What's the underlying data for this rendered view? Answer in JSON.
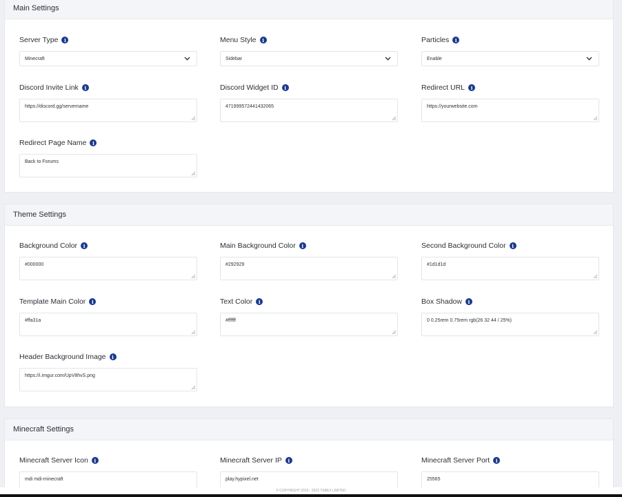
{
  "main_settings": {
    "title": "Main Settings",
    "server_type": {
      "label": "Server Type",
      "value": "Minecraft"
    },
    "menu_style": {
      "label": "Menu Style",
      "value": "Sidebar"
    },
    "particles": {
      "label": "Particles",
      "value": "Enable"
    },
    "discord_invite": {
      "label": "Discord Invite Link",
      "value": "https://discord.gg/servername"
    },
    "discord_widget": {
      "label": "Discord Widget ID",
      "value": "471999572441432065"
    },
    "redirect_url": {
      "label": "Redirect URL",
      "value": "https://yourwebsite.com"
    },
    "redirect_page_name": {
      "label": "Redirect Page Name",
      "value": "Back to Forums"
    }
  },
  "theme_settings": {
    "title": "Theme Settings",
    "background_color": {
      "label": "Background Color",
      "value": "#000000"
    },
    "main_background_color": {
      "label": "Main Background Color",
      "value": "#292929"
    },
    "second_background_color": {
      "label": "Second Background Color",
      "value": "#1d1d1d"
    },
    "template_main_color": {
      "label": "Template Main Color",
      "value": "#ffa31a"
    },
    "text_color": {
      "label": "Text Color",
      "value": "#ffffff"
    },
    "box_shadow": {
      "label": "Box Shadow",
      "value": "0 0.25rem 0.75rem rgb(26 32 44 / 25%)"
    },
    "header_background_image": {
      "label": "Header Background Image",
      "value": "https://i.imgur.com/UpV8hvS.png"
    }
  },
  "minecraft_settings": {
    "title": "Minecraft Settings",
    "server_icon": {
      "label": "Minecraft Server Icon",
      "value": "mdi mdi-minecraft"
    },
    "server_ip": {
      "label": "Minecraft Server IP",
      "value": "play.hypixel.net"
    },
    "server_port": {
      "label": "Minecraft Server Port",
      "value": "25565"
    }
  },
  "footer": {
    "copyright": "© COPYRIGHT 2015 - 2022 TEBEX LIMITED"
  },
  "icons": {
    "info": "info-icon",
    "dropdown": "chevron-down-icon",
    "resize": "resize-grip-icon"
  },
  "colors": {
    "info_icon": "#1a3a8f",
    "header_bg": "#f4f5f8",
    "page_bg": "#eef0f4"
  }
}
